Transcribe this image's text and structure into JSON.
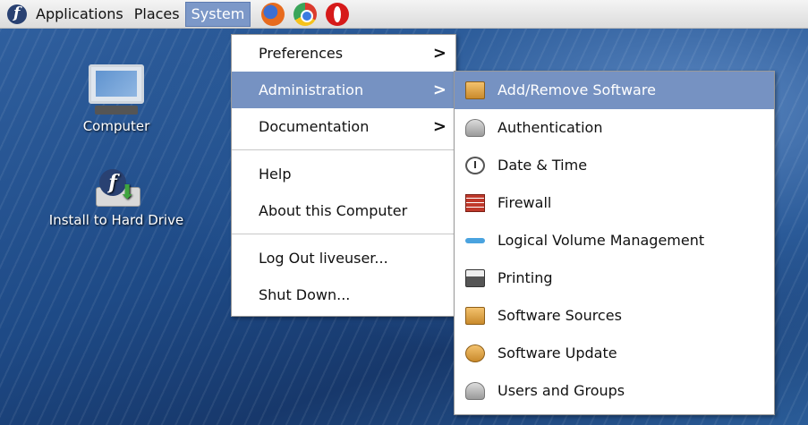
{
  "panel": {
    "menus": [
      "Applications",
      "Places",
      "System"
    ],
    "launchers": [
      "firefox-icon",
      "chrome-icon",
      "opera-icon"
    ]
  },
  "desktop": {
    "icons": [
      {
        "label": "Computer",
        "icon": "computer-icon"
      },
      {
        "label": "Install to Hard Drive",
        "icon": "install-icon"
      }
    ]
  },
  "system_menu": {
    "items": [
      "Preferences",
      "Administration",
      "Documentation",
      "Help",
      "About this Computer",
      "Log Out liveuser...",
      "Shut Down..."
    ],
    "submenu_arrow": ">"
  },
  "admin_menu": {
    "items": [
      {
        "label": "Add/Remove Software",
        "icon": "package-icon"
      },
      {
        "label": "Authentication",
        "icon": "authentication-icon"
      },
      {
        "label": "Date & Time",
        "icon": "clock-icon"
      },
      {
        "label": "Firewall",
        "icon": "firewall-icon"
      },
      {
        "label": "Logical Volume Management",
        "icon": "volume-icon"
      },
      {
        "label": "Printing",
        "icon": "printer-icon"
      },
      {
        "label": "Software Sources",
        "icon": "sources-icon"
      },
      {
        "label": "Software Update",
        "icon": "update-icon"
      },
      {
        "label": "Users and Groups",
        "icon": "users-icon"
      }
    ]
  },
  "colors": {
    "selection": "#7692c2",
    "desktop": "#1e4a86"
  }
}
